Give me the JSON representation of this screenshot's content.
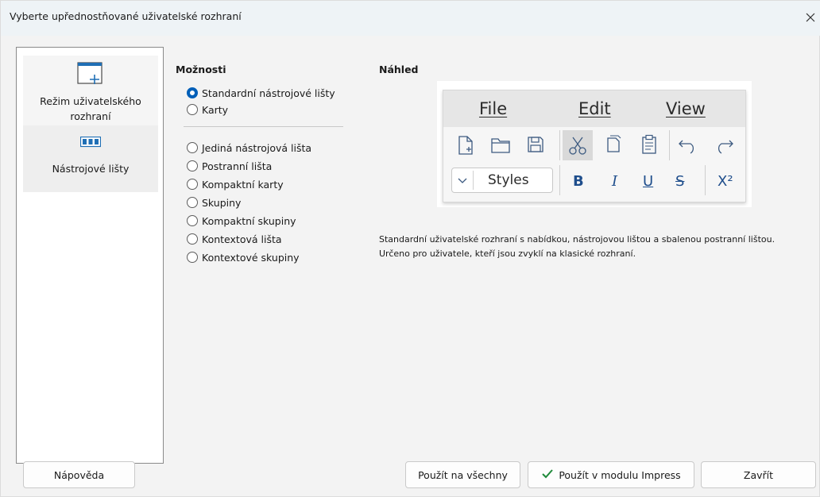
{
  "window": {
    "title": "Vyberte upřednostňované uživatelské rozhraní"
  },
  "sidebar": {
    "items": [
      {
        "label": "Režim uživatelského rozhraní",
        "icon": "ui-mode-icon"
      },
      {
        "label": "Nástrojové lišty",
        "icon": "toolbars-icon"
      }
    ]
  },
  "options": {
    "heading": "Možnosti",
    "group1": [
      {
        "label": "Standardní nástrojové lišty",
        "checked": true
      },
      {
        "label": "Karty",
        "checked": false
      }
    ],
    "group2": [
      {
        "label": "Jediná nástrojová lišta",
        "checked": false
      },
      {
        "label": "Postranní lišta",
        "checked": false
      },
      {
        "label": "Kompaktní karty",
        "checked": false
      },
      {
        "label": "Skupiny",
        "checked": false
      },
      {
        "label": "Kompaktní skupiny",
        "checked": false
      },
      {
        "label": "Kontextová lišta",
        "checked": false
      },
      {
        "label": "Kontextové skupiny",
        "checked": false
      }
    ]
  },
  "preview": {
    "heading": "Náhled",
    "menu": [
      "File",
      "Edit",
      "View"
    ],
    "styles_box": "Styles",
    "format": {
      "bold": "B",
      "italic": "I",
      "underline": "U",
      "strike": "S",
      "superscript": "X²"
    }
  },
  "description": "Standardní uživatelské rozhraní s nabídkou, nástrojovou lištou a sbalenou postranní lištou. Určeno pro uživatele, kteří jsou zvyklí na klasické rozhraní.",
  "buttons": {
    "help": "Nápověda",
    "apply_all": "Použít na všechny",
    "apply_impress": "Použít v modulu Impress",
    "close": "Zavřít"
  },
  "colors": {
    "accent": "#005fb8",
    "check": "#1f8a3a",
    "preview_format": "#1f4e8c"
  }
}
